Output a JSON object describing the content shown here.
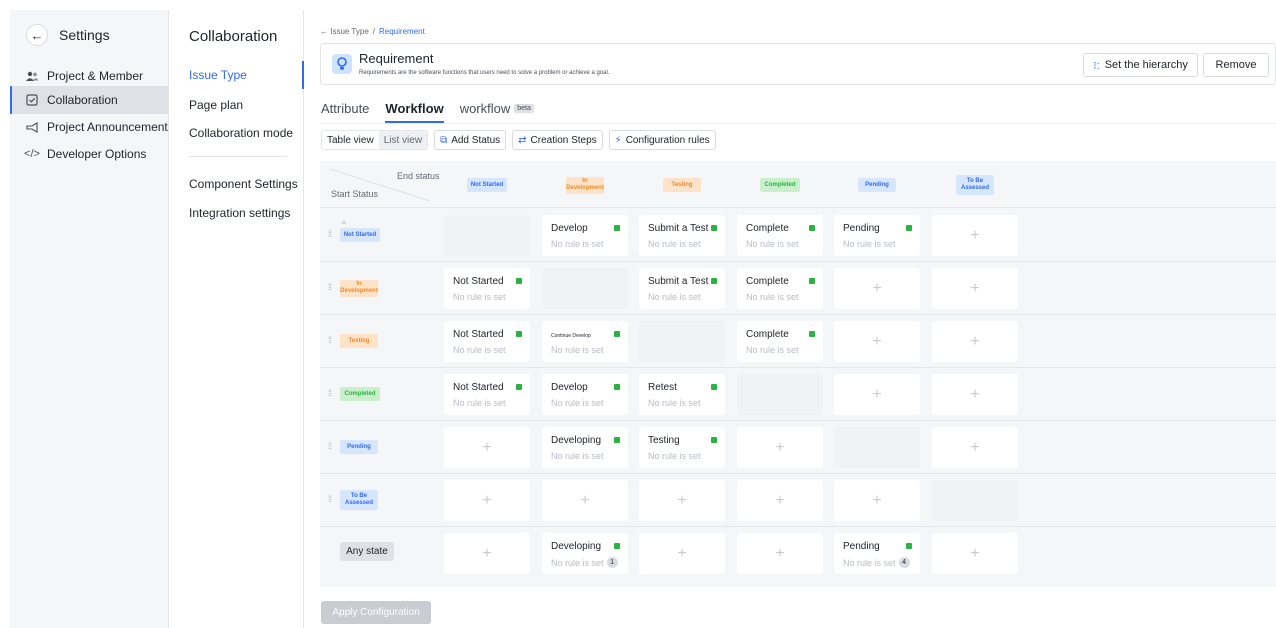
{
  "sidebar": {
    "title": "Settings",
    "items": [
      {
        "label": "Project & Member",
        "icon": "people-icon"
      },
      {
        "label": "Collaboration",
        "icon": "checkbox-icon"
      },
      {
        "label": "Project Announcement",
        "icon": "megaphone-icon"
      },
      {
        "label": "Developer Options",
        "icon": "code-icon"
      }
    ]
  },
  "panel": {
    "title": "Collaboration",
    "items": [
      "Issue Type",
      "Page plan",
      "Collaboration mode"
    ],
    "items2": [
      "Component Settings",
      "Integration settings"
    ]
  },
  "breadcrumb": {
    "back": "← Issue Type",
    "sep": "/",
    "current": "Requirement"
  },
  "issue": {
    "name": "Requirement",
    "description": "Requirements are the software functions that users need to solve a problem or achieve a goal.",
    "set_hierarchy": "Set the hierarchy",
    "remove": "Remove"
  },
  "tabs": [
    "Attribute",
    "Workflow",
    "workflow"
  ],
  "beta": "beta",
  "toolbar": {
    "table_view": "Table view",
    "list_view": "List view",
    "add_status": "Add Status",
    "creation_steps": "Creation Steps",
    "configuration_rules": "Configuration rules"
  },
  "matrix": {
    "end_label": "End status",
    "start_label": "Start Status",
    "statuses": [
      {
        "label": "Not Started",
        "bg": "#d7e6ff",
        "fg": "#2f6bed"
      },
      {
        "label": "In Development",
        "bg": "#ffe3c9",
        "fg": "#f08a24"
      },
      {
        "label": "Testing",
        "bg": "#ffe3c9",
        "fg": "#f08a24"
      },
      {
        "label": "Completed",
        "bg": "#c9efcd",
        "fg": "#28b43e"
      },
      {
        "label": "Pending",
        "bg": "#d7e6ff",
        "fg": "#2f6bed"
      },
      {
        "label": "To Be Assessed",
        "bg": "#d7e6ff",
        "fg": "#2f6bed"
      }
    ],
    "any_state": "Any state",
    "no_rule": "No rule is set",
    "rows": [
      [
        "",
        "Develop",
        "Submit a Test",
        "Complete",
        "Pending",
        "+"
      ],
      [
        "Not Started",
        "",
        "Submit a Test",
        "Complete",
        "+",
        "+"
      ],
      [
        "Not Started",
        "Continue Develop",
        "",
        "Complete",
        "+",
        "+"
      ],
      [
        "Not Started",
        "Develop",
        "Retest",
        "",
        "+",
        "+"
      ],
      [
        "+",
        "Developing",
        "Testing",
        "+",
        "",
        "+"
      ],
      [
        "+",
        "+",
        "+",
        "+",
        "+",
        ""
      ]
    ],
    "any_row": [
      "+",
      "Developing",
      "+",
      "+",
      "Pending",
      "+"
    ],
    "any_counts": [
      "",
      "1",
      "",
      "",
      "4",
      ""
    ]
  },
  "apply": "Apply Configuration",
  "colors": {
    "accent": "#2f6bed",
    "rule_dot": "#28b43e"
  }
}
